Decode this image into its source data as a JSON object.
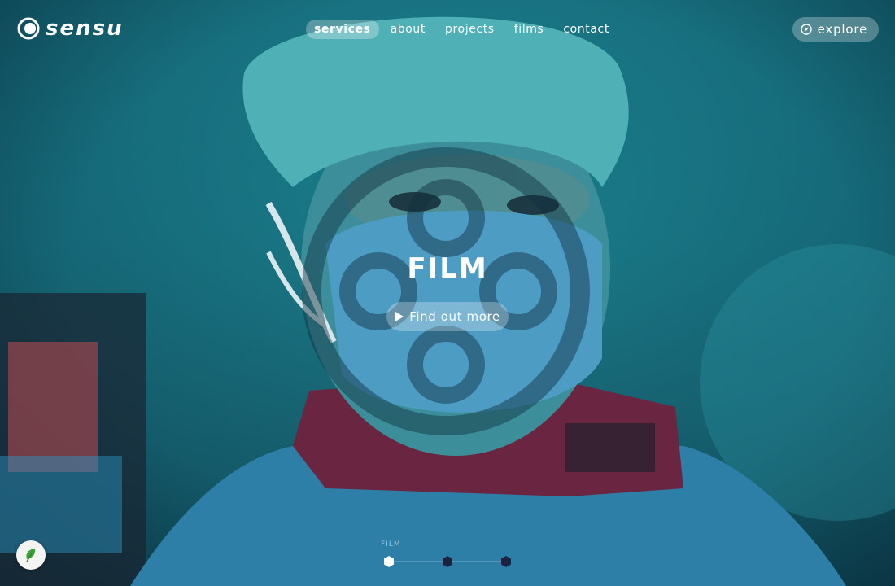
{
  "brand": {
    "name": "sensu"
  },
  "nav": {
    "items": [
      {
        "label": "services",
        "active": true
      },
      {
        "label": "about"
      },
      {
        "label": "projects"
      },
      {
        "label": "films"
      },
      {
        "label": "contact"
      }
    ],
    "explore_label": "explore",
    "explore_icon": "compass-icon"
  },
  "hero": {
    "title": "FILM",
    "cta_label": "Find out more",
    "cta_icon": "play-icon"
  },
  "slider": {
    "caption": "FILM",
    "dots": 3,
    "active_index": 0
  },
  "widget": {
    "icon": "leaf-icon",
    "accent": "#3aa33c"
  },
  "colors": {
    "teal": "#1b7f8c",
    "overlay": "#0f3a4a"
  }
}
